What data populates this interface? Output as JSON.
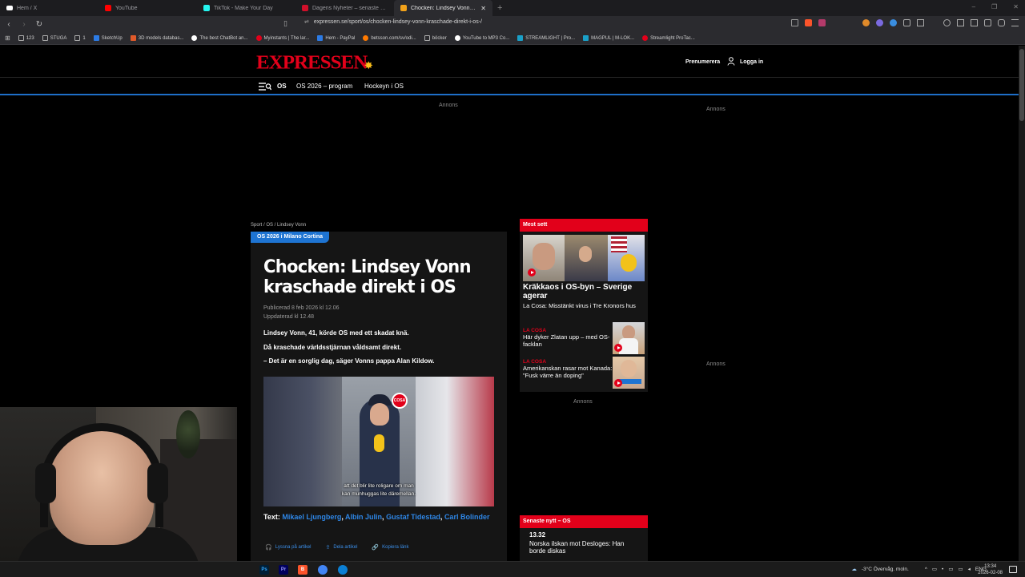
{
  "browser": {
    "tabs": [
      {
        "title": "Hem / X",
        "color": "#ffffff",
        "active": false
      },
      {
        "title": "YouTube",
        "color": "#ff0000",
        "active": false
      },
      {
        "title": "TikTok - Make Your Day",
        "color": "#25f4ee",
        "active": false
      },
      {
        "title": "Dagens Nyheter – senaste nyheterna",
        "color": "#d0102a",
        "active": false
      },
      {
        "title": "Chocken: Lindsey Vonn krascha...",
        "color": "#f2a21a",
        "active": true
      }
    ],
    "url": "expressen.se/sport/os/chocken-lindsey-vonn-kraschade-direkt-i-os-/",
    "bookmarks": [
      {
        "label": "123",
        "color": "#888888"
      },
      {
        "label": "STUGA",
        "color": "#888888"
      },
      {
        "label": "1",
        "color": "#888888"
      },
      {
        "label": "SketchUp",
        "color": "#2c7be5"
      },
      {
        "label": "3D models databas...",
        "color": "#e05a2a"
      },
      {
        "label": "The best ChatBot an...",
        "color": "#ffffff"
      },
      {
        "label": "Myinstants | The lar...",
        "color": "#e2001a"
      },
      {
        "label": "Hem - PayPal",
        "color": "#2c7be5"
      },
      {
        "label": "betsson.com/sv/odi...",
        "color": "#ff7a00"
      },
      {
        "label": "böcker",
        "color": "#888888"
      },
      {
        "label": "YouTube to MP3 Co...",
        "color": "#ffffff"
      },
      {
        "label": "STREAMLIGHT | Pro...",
        "color": "#1aa0c8"
      },
      {
        "label": "MAGPUL | M-LOK...",
        "color": "#1aa0c8"
      },
      {
        "label": "Streamlight ProTac...",
        "color": "#e2001a"
      }
    ],
    "window_controls": [
      "–",
      "❐",
      "✕"
    ]
  },
  "site": {
    "logo": "EXPRESSEN",
    "subscribe": "Prenumerera",
    "login": "Logga in",
    "nav": [
      "OS",
      "OS 2026 – program",
      "Hockeyn i OS"
    ],
    "ad_label": "Annons"
  },
  "article": {
    "breadcrumb": "Sport / OS / Lindsey Vonn",
    "badge": "OS 2026 i Milano Cortina",
    "headline": "Chocken: Lindsey Vonn kraschade direkt i OS",
    "published": "Publicerad 8 feb 2026 kl 12.06",
    "updated": "Uppdaterad kl 12.48",
    "lead": [
      "Lindsey Vonn, 41, körde OS med ett skadat knä.",
      "Då kraschade världsstjärnan våldsamt direkt.",
      "– Det är en sorglig dag, säger Vonns pappa Alan Kildow."
    ],
    "video_logo": "COSA",
    "video_subtitle": [
      "att det blir lite roligare om man",
      "kan munhuggas lite däremellan."
    ],
    "byline_label": "Text:",
    "authors": [
      "Mikael Ljungberg",
      "Albin Julin",
      "Gustaf Tidestad",
      "Carl Bolinder"
    ],
    "actions": [
      "Lyssna på artikel",
      "Dela artikel",
      "Kopiera länk"
    ]
  },
  "sidebar": {
    "most_read": {
      "heading": "Mest sett",
      "hero_title": "Kräkkaos i OS-byn – Sverige agerar",
      "hero_sub": "La Cosa: Misstänkt virus i Tre Kronors hus",
      "items": [
        {
          "kicker": "LA COSA",
          "title": "Här dyker Zlatan upp – med OS-facklan"
        },
        {
          "kicker": "LA COSA",
          "title": "Amerikanskan rasar mot Kanada: \"Fusk värre än doping\""
        }
      ]
    },
    "latest": {
      "heading": "Senaste nytt – OS",
      "time": "13.32",
      "title": "Norska ilskan mot Desloges: Han borde diskas"
    }
  },
  "taskbar": {
    "apps": [
      {
        "label": "Ps",
        "color": "#31a8ff",
        "bg": "#001e36"
      },
      {
        "label": "Pr",
        "color": "#9999ff",
        "bg": "#00005b"
      },
      {
        "label": "B",
        "color": "#ffffff",
        "bg": "#fb542b"
      },
      {
        "label": "",
        "color": "#ffffff",
        "bg": "#4285f4"
      },
      {
        "label": "",
        "color": "#ffffff",
        "bg": "#0b7fd4"
      }
    ],
    "weather": "-3°C  Övervåg. moln.",
    "lang": "ENG",
    "time": "13:34",
    "date": "2026-02-08"
  }
}
